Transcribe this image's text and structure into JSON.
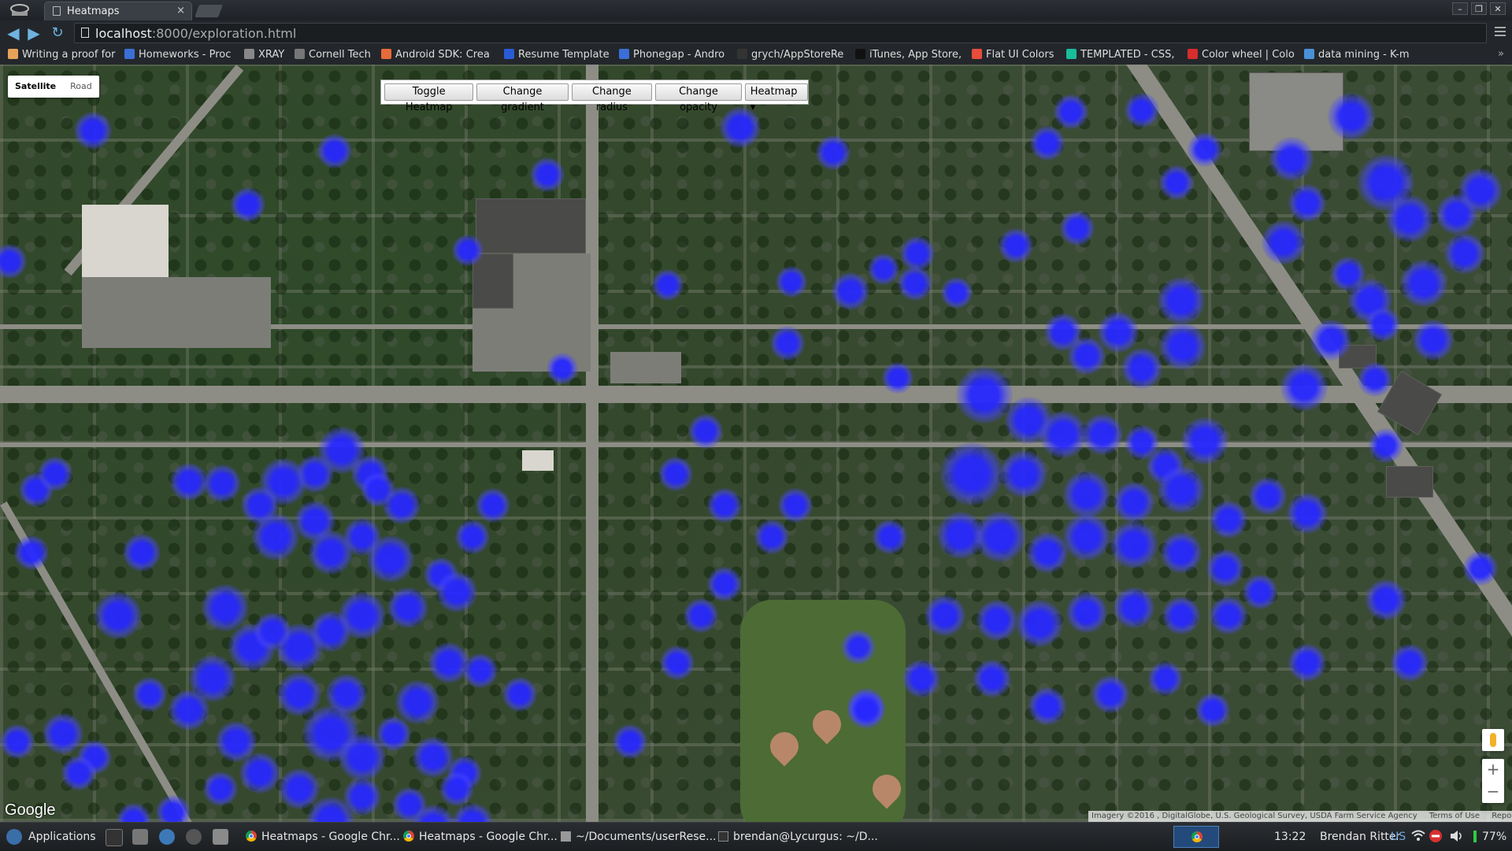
{
  "browser": {
    "tab_title": "Heatmaps",
    "tab_close": "×",
    "url_host": "localhost",
    "url_path": ":8000/exploration.html",
    "window_controls": [
      "–",
      "❐",
      "✕"
    ]
  },
  "bookmarks": [
    {
      "label": "Writing a proof for",
      "icon_color": "#e8a35a"
    },
    {
      "label": "Homeworks - Proc",
      "icon_color": "#3b6fd6"
    },
    {
      "label": "XRAY",
      "icon_color": "#888888"
    },
    {
      "label": "Cornell Tech",
      "icon_color": "#777777"
    },
    {
      "label": "Android SDK: Crea",
      "icon_color": "#e86a3a"
    },
    {
      "label": "Resume Template",
      "icon_color": "#2a5bd7"
    },
    {
      "label": "Phonegap - Andro",
      "icon_color": "#3b6fd6"
    },
    {
      "label": "grych/AppStoreRe",
      "icon_color": "#333333"
    },
    {
      "label": "iTunes, App Store,",
      "icon_color": "#111111"
    },
    {
      "label": "Flat UI Colors",
      "icon_color": "#e74c3c"
    },
    {
      "label": "TEMPLATED - CSS,",
      "icon_color": "#1abc9c"
    },
    {
      "label": "Color wheel | Colo",
      "icon_color": "#d62d2d"
    },
    {
      "label": "data mining - K-m",
      "icon_color": "#4a90d9"
    }
  ],
  "bookmarks_more": "»",
  "map": {
    "type_options": [
      "Satellite",
      "Road"
    ],
    "active_type": "Satellite",
    "controls": {
      "toggle": "Toggle Heatmap",
      "gradient": "Change gradient",
      "radius": "Change radius",
      "opacity": "Change opacity",
      "select_value": "Heatmap"
    },
    "logo": "Google",
    "attribution": "Imagery ©2016 , DigitalGlobe, U.S. Geological Survey, USDA Farm Service Agency",
    "terms": "Terms of Use",
    "report": "Report a map error",
    "zoom_in": "+",
    "zoom_out": "−",
    "heatmap_color": "#2828ff"
  },
  "taskbar": {
    "applications": "Applications",
    "items": [
      "Heatmaps - Google Chr...",
      "Heatmaps - Google Chr...",
      "~/Documents/userRese...",
      "brendan@Lycurgus: ~/D..."
    ],
    "time": "13:22",
    "user": "Brendan Ritter",
    "keyboard": "US",
    "battery": "77%"
  }
}
